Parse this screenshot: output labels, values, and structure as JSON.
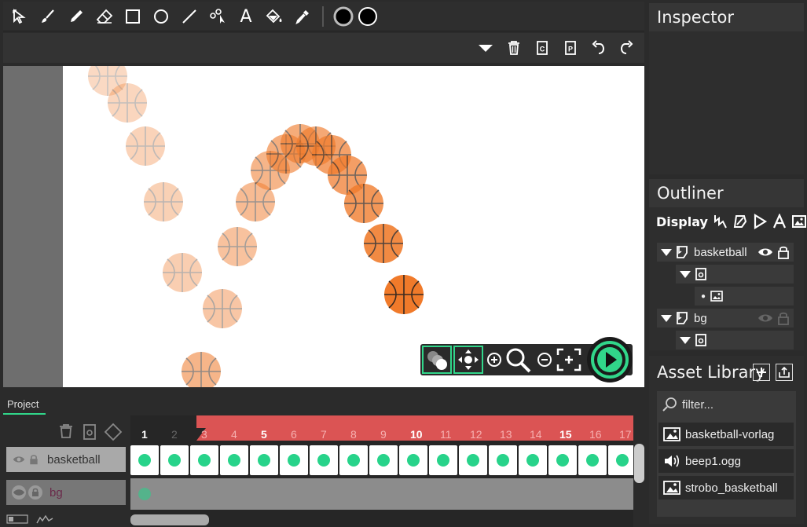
{
  "toolbar": {
    "tools": [
      "select-arrow-icon",
      "brush-icon",
      "pencil-icon",
      "eraser-icon",
      "rectangle-icon",
      "ellipse-icon",
      "line-icon",
      "path-edit-icon",
      "text-icon",
      "fill-bucket-icon",
      "eyedropper-icon",
      "stroke-color-icon",
      "fill-color-icon"
    ],
    "text_tool_label": "A"
  },
  "actionbar": {
    "icons": [
      "dropdown-icon",
      "delete-icon",
      "copy-icon",
      "paste-icon",
      "undo-icon",
      "redo-icon"
    ],
    "copy_glyph": "C",
    "paste_glyph": "P"
  },
  "inspector": {
    "title": "Inspector"
  },
  "outliner": {
    "title": "Outliner",
    "display_label": "Display",
    "rows": [
      {
        "label": "basketball"
      },
      {
        "label": "bg"
      }
    ]
  },
  "asset_library": {
    "title": "Asset Library",
    "filter_placeholder": "filter...",
    "assets": [
      {
        "name": "basketball-vorlag",
        "icon": "image-icon"
      },
      {
        "name": "beep1.ogg",
        "icon": "sound-icon"
      },
      {
        "name": "strobo_basketball",
        "icon": "image-icon"
      }
    ]
  },
  "timeline": {
    "project_tab": "Project",
    "layers": [
      {
        "name": "basketball"
      },
      {
        "name": "bg"
      }
    ],
    "frame_numbers": [
      "1",
      "2",
      "3",
      "4",
      "5",
      "6",
      "7",
      "8",
      "9",
      "10",
      "11",
      "12",
      "13",
      "14",
      "15",
      "16",
      "17"
    ]
  },
  "colors": {
    "accent": "#31d68a",
    "ball": "#f07a2a",
    "playhead": "#f05a5a"
  }
}
